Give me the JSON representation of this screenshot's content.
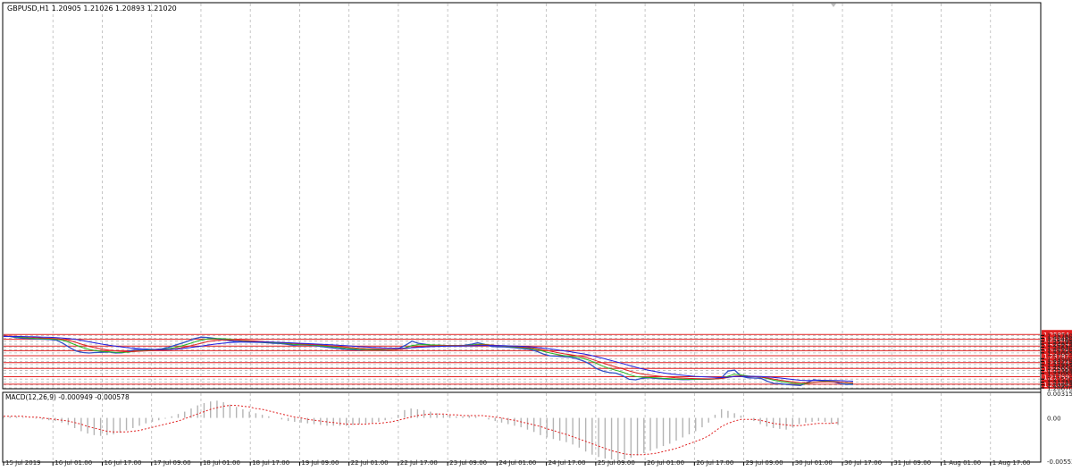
{
  "colors": {
    "price": "#3050c8",
    "ma_fast": "#22b822",
    "ma_mid": "#e02020",
    "ma_slow": "#2020e0",
    "level": "#e02020",
    "grid": "#b8b8b8",
    "macd_hist": "#b4b4b4",
    "macd_signal": "#e02020",
    "axis_text": "#222222"
  },
  "chart_data": [
    {
      "type": "line",
      "title": "GBPUSD,H1  1.20905 1.21026 1.20893 1.21020",
      "ylim": [
        1.2067,
        1.5796
      ],
      "price_ticks": [
        "1.25760",
        "1.25480",
        "1.25195",
        "1.24915",
        "1.24630",
        "1.24350",
        "1.24065",
        "1.23500",
        "1.23215",
        "1.22935",
        "1.22650",
        "1.22365",
        "1.22085",
        "1.21520",
        "1.21235",
        "1.20955",
        "1.20670"
      ],
      "levels": [
        "1.25854",
        "1.25382",
        "1.24727",
        "1.24275",
        "1.23787",
        "1.23124",
        "1.22555",
        "1.21759",
        "1.21029"
      ],
      "time_labels": [
        "15 Jul 2019",
        "16 Jul 01:00",
        "16 Jul 17:00",
        "17 Jul 09:00",
        "18 Jul 01:00",
        "18 Jul 17:00",
        "19 Jul 09:00",
        "22 Jul 01:00",
        "22 Jul 17:00",
        "23 Jul 09:00",
        "24 Jul 01:00",
        "24 Jul 17:00",
        "25 Jul 09:00",
        "26 Jul 01:00",
        "26 Jul 17:00",
        "29 Jul 09:00",
        "30 Jul 01:00",
        "30 Jul 17:00",
        "31 Jul 09:00",
        "1 Aug 01:00",
        "1 Aug 17:00"
      ],
      "series": [
        {
          "values": [
            1.2576,
            1.2566,
            1.2554,
            1.2548,
            1.2545,
            1.2542,
            1.254,
            1.2536,
            1.253,
            1.25,
            1.246,
            1.2425,
            1.241,
            1.2405,
            1.241,
            1.2412,
            1.2415,
            1.2405,
            1.2408,
            1.2425,
            1.244,
            1.2435,
            1.2438,
            1.244,
            1.2445,
            1.246,
            1.248,
            1.25,
            1.252,
            1.2545,
            1.256,
            1.2555,
            1.2548,
            1.254,
            1.2528,
            1.252,
            1.2515,
            1.2512,
            1.251,
            1.2508,
            1.2505,
            1.25,
            1.2498,
            1.249,
            1.248,
            1.2485,
            1.2482,
            1.2478,
            1.247,
            1.2462,
            1.2455,
            1.2448,
            1.2442,
            1.2438,
            1.2435,
            1.244,
            1.2438,
            1.2436,
            1.2435,
            1.244,
            1.245,
            1.248,
            1.252,
            1.25,
            1.249,
            1.248,
            1.248,
            1.2478,
            1.2478,
            1.2476,
            1.248,
            1.249,
            1.2505,
            1.249,
            1.247,
            1.2465,
            1.2465,
            1.246,
            1.2455,
            1.2448,
            1.244,
            1.242,
            1.2395,
            1.2378,
            1.2375,
            1.237,
            1.2365,
            1.235,
            1.233,
            1.23,
            1.2255,
            1.223,
            1.2215,
            1.221,
            1.2185,
            1.215,
            1.2145,
            1.216,
            1.2165,
            1.2158,
            1.2155,
            1.2152,
            1.215,
            1.2148,
            1.2148,
            1.215,
            1.2152,
            1.215,
            1.2155,
            1.2165,
            1.223,
            1.224,
            1.218,
            1.2165,
            1.2162,
            1.216,
            1.213,
            1.211,
            1.2108,
            1.21,
            1.2095,
            1.209,
            1.212,
            1.2145,
            1.214,
            1.2135,
            1.2125,
            1.211,
            1.21,
            1.2102
          ]
        },
        {
          "name": "MA fast",
          "values": [
            1.257,
            1.2566,
            1.2562,
            1.2556,
            1.2551,
            1.2547,
            1.2544,
            1.2541,
            1.2538,
            1.2528,
            1.2508,
            1.2482,
            1.2458,
            1.244,
            1.2428,
            1.2421,
            1.2417,
            1.2412,
            1.241,
            1.2414,
            1.2422,
            1.2428,
            1.2432,
            1.2436,
            1.244,
            1.2447,
            1.2458,
            1.2474,
            1.2492,
            1.2512,
            1.253,
            1.2541,
            1.2545,
            1.2545,
            1.2541,
            1.2534,
            1.2527,
            1.2521,
            1.2516,
            1.2512,
            1.2509,
            1.2505,
            1.2502,
            1.2497,
            1.249,
            1.2487,
            1.2485,
            1.2482,
            1.2477,
            1.2471,
            1.2465,
            1.2458,
            1.2451,
            1.2446,
            1.2441,
            1.244,
            1.2439,
            1.2438,
            1.2437,
            1.2438,
            1.2442,
            1.2456,
            1.2478,
            1.2485,
            1.2487,
            1.2484,
            1.2482,
            1.248,
            1.2479,
            1.2478,
            1.2478,
            1.2482,
            1.249,
            1.249,
            1.2483,
            1.2477,
            1.2472,
            1.2467,
            1.2462,
            1.2456,
            1.2449,
            1.2438,
            1.2422,
            1.2405,
            1.2392,
            1.2382,
            1.2375,
            1.2365,
            1.2352,
            1.2333,
            1.2305,
            1.2278,
            1.2255,
            1.2238,
            1.222,
            1.2195,
            1.2177,
            1.217,
            1.2168,
            1.2164,
            1.216,
            1.2157,
            1.2154,
            1.2152,
            1.215,
            1.215,
            1.2151,
            1.2151,
            1.2153,
            1.2158,
            1.218,
            1.22,
            1.2193,
            1.2183,
            1.2176,
            1.2171,
            1.2157,
            1.2141,
            1.213,
            1.212,
            1.2111,
            1.2104,
            1.211,
            1.2122,
            1.2128,
            1.2131,
            1.2129,
            1.2123,
            1.2115,
            1.211
          ]
        },
        {
          "name": "MA mid",
          "values": [
            1.2572,
            1.257,
            1.2567,
            1.2563,
            1.2559,
            1.2555,
            1.2551,
            1.2548,
            1.2545,
            1.2538,
            1.2526,
            1.2508,
            1.2488,
            1.247,
            1.2455,
            1.2443,
            1.2434,
            1.2426,
            1.242,
            1.2418,
            1.242,
            1.2423,
            1.2427,
            1.243,
            1.2434,
            1.2439,
            1.2446,
            1.2456,
            1.2469,
            1.2485,
            1.2501,
            1.2515,
            1.2525,
            1.2531,
            1.2533,
            1.2532,
            1.2529,
            1.2526,
            1.2522,
            1.2518,
            1.2514,
            1.251,
            1.2507,
            1.2503,
            1.2498,
            1.2494,
            1.2491,
            1.2488,
            1.2484,
            1.2479,
            1.2474,
            1.2468,
            1.2462,
            1.2456,
            1.2451,
            1.2448,
            1.2446,
            1.2444,
            1.2442,
            1.2441,
            1.2442,
            1.2448,
            1.246,
            1.2468,
            1.2473,
            1.2475,
            1.2476,
            1.2476,
            1.2476,
            1.2476,
            1.2476,
            1.2478,
            1.2482,
            1.2484,
            1.2482,
            1.2479,
            1.2475,
            1.2471,
            1.2467,
            1.2462,
            1.2456,
            1.2448,
            1.2436,
            1.2423,
            1.241,
            1.2399,
            1.239,
            1.238,
            1.2368,
            1.2352,
            1.233,
            1.2308,
            1.2288,
            1.227,
            1.2252,
            1.2232,
            1.2214,
            1.2201,
            1.2192,
            1.2184,
            1.2177,
            1.2171,
            1.2166,
            1.2162,
            1.2159,
            1.2157,
            1.2156,
            1.2155,
            1.2155,
            1.2157,
            1.2168,
            1.2181,
            1.2183,
            1.218,
            1.2176,
            1.2172,
            1.2163,
            1.2151,
            1.2141,
            1.2132,
            1.2124,
            1.2116,
            1.2116,
            1.2121,
            1.2124,
            1.2126,
            1.2126,
            1.2123,
            1.2118,
            1.2115
          ]
        },
        {
          "name": "MA slow",
          "values": [
            1.2566,
            1.2566,
            1.2566,
            1.2565,
            1.2564,
            1.2562,
            1.256,
            1.2558,
            1.2555,
            1.2551,
            1.2545,
            1.2537,
            1.2526,
            1.2514,
            1.2502,
            1.2491,
            1.2481,
            1.2472,
            1.2463,
            1.2456,
            1.245,
            1.2446,
            1.2443,
            1.244,
            1.2439,
            1.244,
            1.2443,
            1.2448,
            1.2455,
            1.2463,
            1.2473,
            1.2482,
            1.2491,
            1.2499,
            1.2505,
            1.2509,
            1.2512,
            1.2513,
            1.2513,
            1.2513,
            1.2512,
            1.251,
            1.2508,
            1.2506,
            1.2503,
            1.25,
            1.2497,
            1.2494,
            1.2491,
            1.2488,
            1.2484,
            1.248,
            1.2476,
            1.2472,
            1.2467,
            1.2463,
            1.246,
            1.2457,
            1.2454,
            1.2452,
            1.2451,
            1.2452,
            1.2456,
            1.246,
            1.2464,
            1.2467,
            1.2469,
            1.2471,
            1.2472,
            1.2473,
            1.2474,
            1.2475,
            1.2477,
            1.2478,
            1.2478,
            1.2477,
            1.2476,
            1.2474,
            1.2472,
            1.2469,
            1.2465,
            1.246,
            1.2453,
            1.2445,
            1.2436,
            1.2427,
            1.2418,
            1.2408,
            1.2397,
            1.2385,
            1.237,
            1.2354,
            1.2337,
            1.232,
            1.2303,
            1.2285,
            1.2267,
            1.2251,
            1.2237,
            1.2225,
            1.2214,
            1.2205,
            1.2197,
            1.219,
            1.2184,
            1.2179,
            1.2175,
            1.2172,
            1.2169,
            1.2167,
            1.217,
            1.2176,
            1.2179,
            1.218,
            1.2179,
            1.2178,
            1.2174,
            1.2168,
            1.2162,
            1.2155,
            1.2148,
            1.2141,
            1.2139,
            1.2139,
            1.214,
            1.214,
            1.2139,
            1.2137,
            1.2134,
            1.2132
          ]
        }
      ]
    },
    {
      "type": "bar",
      "title": "MACD(12,26,9) -0.000949 -0.000578",
      "ylim": [
        -0.005531,
        0.003151
      ],
      "ticks": [
        "0.003151",
        "0.00",
        "-0.005531"
      ],
      "histogram": [
        0.0001,
        0.0002,
        0.0002,
        0.0001,
        0.0,
        -0.0001,
        -0.0002,
        -0.0003,
        -0.0004,
        -0.0006,
        -0.0009,
        -0.0013,
        -0.0017,
        -0.002,
        -0.0022,
        -0.0023,
        -0.0022,
        -0.0021,
        -0.0019,
        -0.0016,
        -0.0013,
        -0.001,
        -0.0007,
        -0.0005,
        -0.0003,
        -0.0001,
        0.0002,
        0.0005,
        0.0008,
        0.0012,
        0.0016,
        0.0019,
        0.0021,
        0.0022,
        0.002,
        0.0017,
        0.0014,
        0.0011,
        0.0008,
        0.0006,
        0.0004,
        0.0002,
        0.0,
        -0.0002,
        -0.0004,
        -0.0005,
        -0.0006,
        -0.0007,
        -0.0008,
        -0.0009,
        -0.001,
        -0.001,
        -0.001,
        -0.001,
        -0.0009,
        -0.0008,
        -0.0007,
        -0.0006,
        -0.0005,
        -0.0003,
        -0.0001,
        0.0004,
        0.001,
        0.0012,
        0.0011,
        0.001,
        0.0008,
        0.0006,
        0.0004,
        0.0003,
        0.0002,
        0.0002,
        0.0003,
        0.0002,
        0.0,
        -0.0002,
        -0.0004,
        -0.0006,
        -0.0008,
        -0.001,
        -0.0012,
        -0.0015,
        -0.0018,
        -0.0022,
        -0.0025,
        -0.0027,
        -0.0029,
        -0.0031,
        -0.0034,
        -0.0038,
        -0.0043,
        -0.0047,
        -0.005,
        -0.0052,
        -0.0053,
        -0.0054,
        -0.0053,
        -0.0051,
        -0.0048,
        -0.0045,
        -0.0042,
        -0.0039,
        -0.0036,
        -0.0033,
        -0.0029,
        -0.0025,
        -0.0021,
        -0.0017,
        -0.0012,
        -0.0006,
        0.0004,
        0.0011,
        0.0009,
        0.0006,
        0.0003,
        0.0,
        -0.0004,
        -0.0008,
        -0.0011,
        -0.0013,
        -0.0014,
        -0.0015,
        -0.0012,
        -0.0008,
        -0.0006,
        -0.0005,
        -0.0004,
        -0.0005,
        -0.0007,
        -0.0009
      ],
      "signal": [
        0.0002,
        0.0002,
        0.0002,
        0.0002,
        0.0001,
        0.0001,
        0.0,
        -0.0001,
        -0.0002,
        -0.0003,
        -0.0004,
        -0.0006,
        -0.0008,
        -0.0011,
        -0.0013,
        -0.0015,
        -0.0017,
        -0.0018,
        -0.0018,
        -0.0018,
        -0.0017,
        -0.0016,
        -0.0014,
        -0.0012,
        -0.001,
        -0.0008,
        -0.0006,
        -0.0004,
        -0.0001,
        0.0002,
        0.0005,
        0.0008,
        0.0011,
        0.0013,
        0.0015,
        0.0016,
        0.0016,
        0.0015,
        0.0014,
        0.0012,
        0.0011,
        0.0009,
        0.0007,
        0.0005,
        0.0003,
        0.0001,
        0.0,
        -0.0002,
        -0.0003,
        -0.0004,
        -0.0005,
        -0.0006,
        -0.0007,
        -0.0008,
        -0.0008,
        -0.0008,
        -0.0008,
        -0.0007,
        -0.0007,
        -0.0006,
        -0.0005,
        -0.0003,
        -0.0001,
        0.0001,
        0.0003,
        0.0004,
        0.0005,
        0.0005,
        0.0005,
        0.0004,
        0.0004,
        0.0003,
        0.0003,
        0.0003,
        0.0003,
        0.0002,
        0.0001,
        0.0,
        -0.0002,
        -0.0003,
        -0.0005,
        -0.0007,
        -0.0009,
        -0.0011,
        -0.0014,
        -0.0016,
        -0.0019,
        -0.0021,
        -0.0024,
        -0.0027,
        -0.003,
        -0.0033,
        -0.0036,
        -0.0039,
        -0.0042,
        -0.0044,
        -0.0046,
        -0.0047,
        -0.0047,
        -0.0047,
        -0.0046,
        -0.0045,
        -0.0043,
        -0.0041,
        -0.0039,
        -0.0036,
        -0.0033,
        -0.003,
        -0.0027,
        -0.0023,
        -0.0017,
        -0.0011,
        -0.0007,
        -0.0004,
        -0.0002,
        -0.0002,
        -0.0002,
        -0.0003,
        -0.0005,
        -0.0007,
        -0.0008,
        -0.0009,
        -0.001,
        -0.001,
        -0.0009,
        -0.0008,
        -0.0007,
        -0.0007,
        -0.0007,
        -0.0006
      ]
    }
  ]
}
